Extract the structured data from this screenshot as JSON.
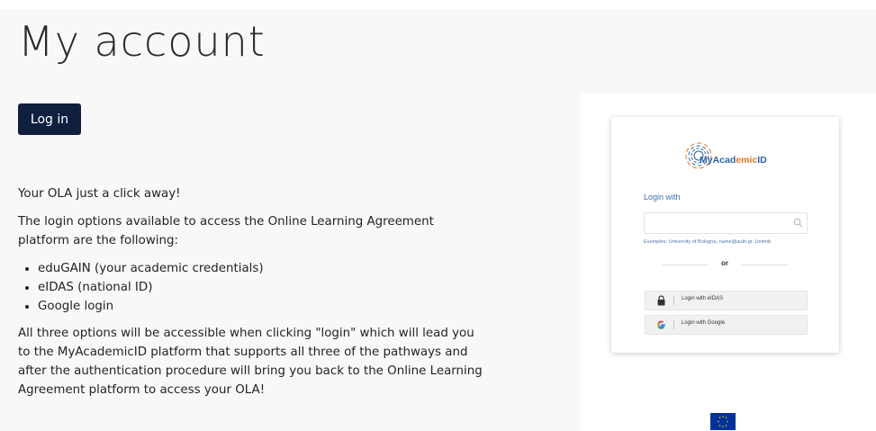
{
  "page": {
    "title": "My account",
    "login_button": "Log in"
  },
  "content": {
    "intro": "Your OLA just a click away!",
    "options_text": "The login options available to access the Online Learning Agreement platform are the following:",
    "options": [
      "eduGAIN (your academic credentials)",
      "eIDAS (national ID)",
      "Google login"
    ],
    "closing": "All three options will be accessible when clicking \"login\" which will lead you to the MyAcademicID platform that supports all three of the pathways and after the authentication procedure will bring you back to the Online Learning Agreement platform to access your OLA!"
  },
  "preview": {
    "logo_text_part1": "MyAcad",
    "logo_text_highlight": "emic",
    "logo_text_part2": "ID",
    "login_with": "Login with",
    "search_placeholder": "",
    "examples": "Examples: University of Bologna, name@auth.gr, Unimib",
    "or": "or",
    "eidas_label": "Login with eIDAS",
    "google_label": "Login with Google"
  },
  "colors": {
    "button_bg": "#0f1f3d",
    "logo_blue": "#2a64a8",
    "logo_orange": "#e8732a",
    "eu_blue": "#003399",
    "eu_star": "#ffcc00"
  },
  "icons": [
    "search-icon",
    "lock-icon",
    "google-icon",
    "eu-flag-icon",
    "myacademicid-logo-icon"
  ]
}
